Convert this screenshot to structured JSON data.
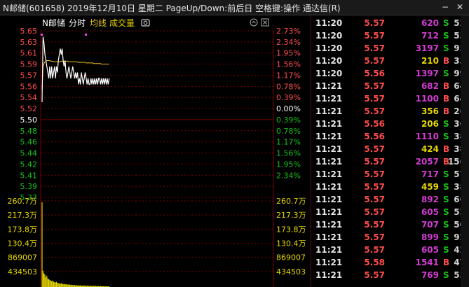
{
  "window": {
    "title": "N邮储(601658) 2019年12月10日 星期二 PageUp/Down:前后日 空格键:操作 通达信(R)",
    "minimize_symbol": "−",
    "close_symbol": "✕"
  },
  "chart_header": {
    "stock_name": "N邮储",
    "tab_timeshare": "分时",
    "legend_avg": "均线",
    "legend_volume": "成交量"
  },
  "colors": {
    "price_line": "#ffffff",
    "avg_line": "#e6c31e",
    "up": "#ff4d4d",
    "down": "#18c018",
    "flat": "#ffffff",
    "grid": "#7a0000",
    "volume_bar": "#e6d600",
    "vol_axis_label": "#e6d600",
    "marker": "#ff3cff"
  },
  "chart_data": {
    "type": "line",
    "title": "",
    "xlabel": "",
    "ylabel": "",
    "base_price": 5.5,
    "ylim": [
      5.37,
      5.65
    ],
    "price_ticks": [
      "5.65",
      "5.63",
      "5.61",
      "5.59",
      "5.57",
      "5.56",
      "5.54",
      "5.52",
      "5.50",
      "5.48",
      "5.46",
      "5.44",
      "5.42",
      "5.41",
      "5.39",
      "5.37"
    ],
    "pct_ticks": [
      "2.73%",
      "2.34%",
      "1.95%",
      "1.56%",
      "1.17%",
      "0.78%",
      "0.39%",
      "0.00%",
      "0.39%",
      "0.78%",
      "1.17%",
      "1.56%",
      "1.95%",
      "2.34%"
    ],
    "volume_ticks": [
      "260.7万",
      "217.3万",
      "173.8万",
      "130.4万",
      "869007",
      "434503"
    ],
    "volume_ylim": [
      0,
      2607000
    ],
    "series": [
      {
        "values": [
          5.53,
          5.64,
          5.63,
          5.61,
          5.6,
          5.59,
          5.58,
          5.57,
          5.59,
          5.57,
          5.59,
          5.57,
          5.58,
          5.59,
          5.57,
          5.59,
          5.58,
          5.6,
          5.61,
          5.62,
          5.61,
          5.62,
          5.6,
          5.59,
          5.6,
          5.58,
          5.57,
          5.58,
          5.59,
          5.58,
          5.57,
          5.58,
          5.59,
          5.58,
          5.57,
          5.58,
          5.57,
          5.58,
          5.56,
          5.57,
          5.56,
          5.58,
          5.57,
          5.56,
          5.57,
          5.58,
          5.57,
          5.56,
          5.57,
          5.56,
          5.56,
          5.57,
          5.56,
          5.57,
          5.56,
          5.57,
          5.56,
          5.57,
          5.56,
          5.57,
          5.57,
          5.56,
          5.57,
          5.56,
          5.57,
          5.56,
          5.57,
          5.56,
          5.57,
          5.56,
          5.57
        ]
      },
      {
        "values": [
          5.55,
          5.59,
          5.595,
          5.598,
          5.599,
          5.6,
          5.6,
          5.6,
          5.6,
          5.599,
          5.599,
          5.599,
          5.598,
          5.598,
          5.598,
          5.598,
          5.598,
          5.598,
          5.598,
          5.598,
          5.599,
          5.599,
          5.599,
          5.599,
          5.599,
          5.599,
          5.599,
          5.599,
          5.598,
          5.598,
          5.598,
          5.598,
          5.598,
          5.598,
          5.598,
          5.598,
          5.598,
          5.597,
          5.597,
          5.597,
          5.597,
          5.597,
          5.597,
          5.597,
          5.597,
          5.597,
          5.596,
          5.596,
          5.596,
          5.596,
          5.596,
          5.596,
          5.596,
          5.596,
          5.595,
          5.595,
          5.595,
          5.595,
          5.595,
          5.595,
          5.595,
          5.595,
          5.594,
          5.594,
          5.594,
          5.594,
          5.594,
          5.594,
          5.594,
          5.594,
          5.594
        ]
      }
    ],
    "volume": [
      2607000,
      500000,
      420000,
      380000,
      300000,
      350000,
      260000,
      240000,
      220000,
      200000,
      180000,
      200000,
      160000,
      150000,
      140000,
      160000,
      130000,
      120000,
      110000,
      100000,
      120000,
      100000,
      90000,
      100000,
      80000,
      90000,
      80000,
      70000,
      85000,
      70000,
      60000,
      70000,
      60000,
      55000,
      65000,
      50000,
      60000,
      45000,
      50000,
      45000,
      55000,
      40000,
      45000,
      40000,
      50000,
      40000,
      35000,
      45000,
      40000,
      35000,
      40000,
      30000,
      35000,
      30000,
      40000,
      30000,
      35000,
      30000,
      28000,
      30000,
      25000,
      30000,
      25000,
      28000,
      22000,
      25000,
      20000,
      22000,
      18000,
      20000,
      18000
    ],
    "total_points": 241
  },
  "ticks": [
    {
      "time": "11:20",
      "price": "5.57",
      "vol": "620",
      "side": "S",
      "count": "52"
    },
    {
      "time": "11:20",
      "price": "5.57",
      "vol": "712",
      "side": "S",
      "count": "53"
    },
    {
      "time": "11:20",
      "price": "5.57",
      "vol": "3197",
      "side": "S",
      "count": "95"
    },
    {
      "time": "11:20",
      "price": "5.57",
      "vol": "210",
      "side": "B",
      "count": "33"
    },
    {
      "time": "11:20",
      "price": "5.56",
      "vol": "1397",
      "side": "S",
      "count": "99"
    },
    {
      "time": "11:21",
      "price": "5.57",
      "vol": "682",
      "side": "B",
      "count": "64"
    },
    {
      "time": "11:21",
      "price": "5.57",
      "vol": "1100",
      "side": "B",
      "count": "64"
    },
    {
      "time": "11:21",
      "price": "5.57",
      "vol": "356",
      "side": "B",
      "count": "26"
    },
    {
      "time": "11:21",
      "price": "5.56",
      "vol": "206",
      "side": "S",
      "count": "36"
    },
    {
      "time": "11:21",
      "price": "5.56",
      "vol": "1110",
      "side": "S",
      "count": "38"
    },
    {
      "time": "11:21",
      "price": "5.57",
      "vol": "424",
      "side": "B",
      "count": "38"
    },
    {
      "time": "11:21",
      "price": "5.57",
      "vol": "2057",
      "side": "B",
      "count": "156"
    },
    {
      "time": "11:21",
      "price": "5.57",
      "vol": "717",
      "side": "S",
      "count": "57"
    },
    {
      "time": "11:21",
      "price": "5.57",
      "vol": "459",
      "side": "S",
      "count": "38"
    },
    {
      "time": "11:21",
      "price": "5.57",
      "vol": "892",
      "side": "S",
      "count": "66"
    },
    {
      "time": "11:21",
      "price": "5.57",
      "vol": "605",
      "side": "S",
      "count": "52"
    },
    {
      "time": "11:21",
      "price": "5.57",
      "vol": "707",
      "side": "S",
      "count": "50"
    },
    {
      "time": "11:21",
      "price": "5.57",
      "vol": "899",
      "side": "S",
      "count": "92"
    },
    {
      "time": "11:21",
      "price": "5.57",
      "vol": "605",
      "side": "S",
      "count": "42"
    },
    {
      "time": "11:21",
      "price": "5.58",
      "vol": "1541",
      "side": "B",
      "count": "47"
    },
    {
      "time": "11:21",
      "price": "5.57",
      "vol": "769",
      "side": "S",
      "count": "53"
    }
  ],
  "tick_volume_colors": [
    "purple",
    "purple",
    "purple",
    "yellow",
    "purple",
    "purple",
    "purple",
    "yellow",
    "yellow",
    "purple",
    "yellow",
    "purple",
    "purple",
    "yellow",
    "purple",
    "purple",
    "purple",
    "purple",
    "purple",
    "purple",
    "purple"
  ]
}
